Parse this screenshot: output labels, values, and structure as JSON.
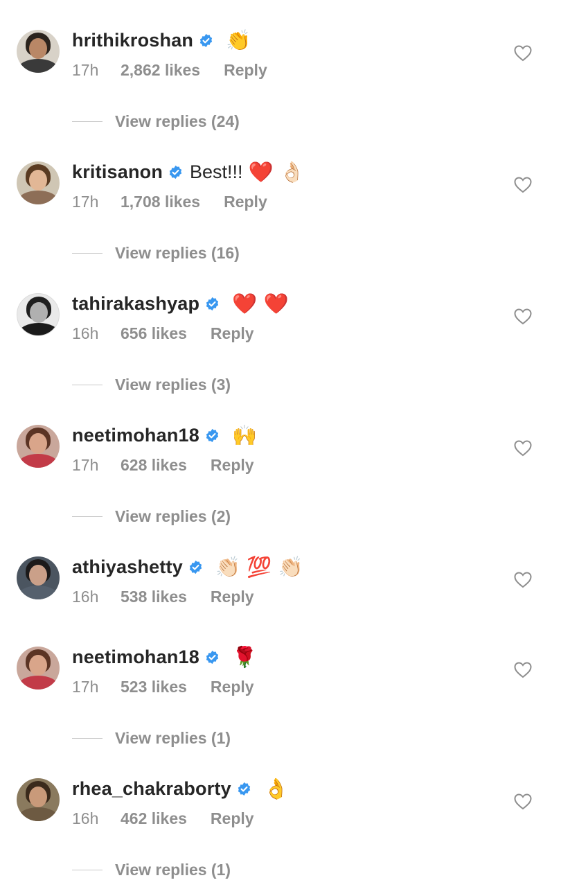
{
  "comments": [
    {
      "username": "hrithikroshan",
      "text": "",
      "emojis": "👏",
      "time": "17h",
      "likes": "2,862 likes",
      "reply": "Reply",
      "view_replies": "View replies (24)",
      "avatar": {
        "bg": "#d8d2c8",
        "hair": "#2b231d",
        "face": "#b98766",
        "body": "#3a3a3a"
      }
    },
    {
      "username": "kritisanon",
      "text": "Best!!!",
      "emojis": "❤️ 👌🏻",
      "time": "17h",
      "likes": "1,708 likes",
      "reply": "Reply",
      "view_replies": "View replies (16)",
      "avatar": {
        "bg": "#cfc6b4",
        "hair": "#5a3b22",
        "face": "#e2b796",
        "body": "#8d6e57"
      }
    },
    {
      "username": "tahirakashyap",
      "text": "",
      "emojis": "❤️ ❤️",
      "time": "16h",
      "likes": "656 likes",
      "reply": "Reply",
      "view_replies": "View replies (3)",
      "avatar": {
        "bg": "#e9e9e9",
        "hair": "#1e1e1e",
        "face": "#b0b0b0",
        "body": "#1a1a1a"
      }
    },
    {
      "username": "neetimohan18",
      "text": "",
      "emojis": "🙌",
      "time": "17h",
      "likes": "628 likes",
      "reply": "Reply",
      "view_replies": "View replies (2)",
      "avatar": {
        "bg": "#c9a79b",
        "hair": "#5b3424",
        "face": "#d9a58a",
        "body": "#c23b48"
      }
    },
    {
      "username": "athiyashetty",
      "text": "",
      "emojis": "👏🏻 💯 👏🏻",
      "time": "16h",
      "likes": "538 likes",
      "reply": "Reply",
      "view_replies": "",
      "avatar": {
        "bg": "#4b5560",
        "hair": "#1c1a1a",
        "face": "#caa089",
        "body": "#55606d"
      }
    },
    {
      "username": "neetimohan18",
      "text": "",
      "emojis": "🌹",
      "time": "17h",
      "likes": "523 likes",
      "reply": "Reply",
      "view_replies": "View replies (1)",
      "avatar": {
        "bg": "#c9a79b",
        "hair": "#5b3424",
        "face": "#d9a58a",
        "body": "#c23b48"
      }
    },
    {
      "username": "rhea_chakraborty",
      "text": "",
      "emojis": "👌",
      "time": "16h",
      "likes": "462 likes",
      "reply": "Reply",
      "view_replies": "View replies (1)",
      "avatar": {
        "bg": "#8a7a5e",
        "hair": "#3a2a1c",
        "face": "#c99a7a",
        "body": "#6d5a42"
      }
    }
  ],
  "colors": {
    "verified_blue": "#3897f0",
    "secondary_text": "#8e8e8e",
    "primary_text": "#262626"
  }
}
